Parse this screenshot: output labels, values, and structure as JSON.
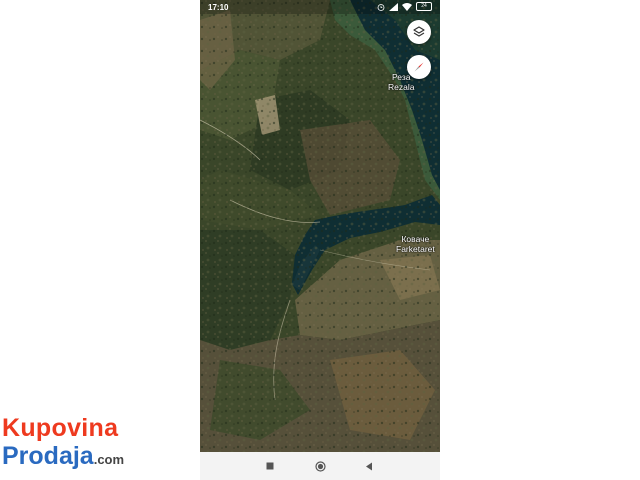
{
  "status_bar": {
    "time": "17:10",
    "battery": "24",
    "icons": [
      "alarm-icon",
      "signal-icon",
      "wifi-icon",
      "battery-icon"
    ]
  },
  "map": {
    "labels": [
      {
        "id": "rezala",
        "line1": "Реза",
        "line2": "Rezala"
      },
      {
        "id": "kovace",
        "line1": "Коваче",
        "line2": "Farketaret"
      }
    ],
    "buttons": {
      "layers": "layers-icon",
      "compass": "compass-icon"
    },
    "colors": {
      "water": "#0f2e33",
      "forest_dark": "#2b3a22",
      "forest_mid": "#4a5533",
      "field_brown": "#7a6a4c",
      "field_light": "#a79a78"
    }
  },
  "nav_bar": {
    "recents": "■",
    "home": "◉",
    "back": "◀"
  },
  "watermark": {
    "line1": "Kupovina",
    "line2": "Prodaja",
    "suffix": ".com",
    "color_red": "#ee3a1f",
    "color_blue": "#2a6ac0"
  }
}
